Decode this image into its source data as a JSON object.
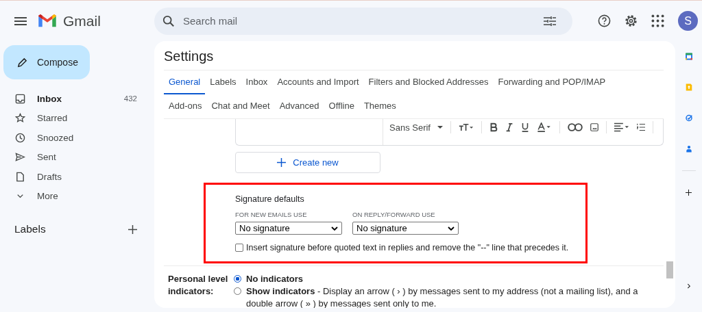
{
  "header": {
    "app_name": "Gmail",
    "search": {
      "placeholder": "Search mail"
    },
    "avatar_letter": "S"
  },
  "sidebar": {
    "compose": "Compose",
    "items": [
      {
        "label": "Inbox",
        "kind": "inbox",
        "count": "432",
        "unread": true
      },
      {
        "label": "Starred",
        "kind": "starred",
        "unread": false
      },
      {
        "label": "Snoozed",
        "kind": "snoozed",
        "unread": false
      },
      {
        "label": "Sent",
        "kind": "sent",
        "unread": false
      },
      {
        "label": "Drafts",
        "kind": "drafts",
        "unread": false
      },
      {
        "label": "More",
        "kind": "more",
        "unread": false
      }
    ],
    "labels_heading": "Labels"
  },
  "settings": {
    "title": "Settings",
    "tab_rows": [
      [
        {
          "label": "General",
          "selected": true
        },
        {
          "label": "Labels",
          "selected": false
        },
        {
          "label": "Inbox",
          "selected": false
        },
        {
          "label": "Accounts and Import",
          "selected": false
        },
        {
          "label": "Filters and Blocked Addresses",
          "selected": false
        },
        {
          "label": "Forwarding and POP/IMAP",
          "selected": false
        }
      ],
      [
        {
          "label": "Add-ons",
          "selected": false
        },
        {
          "label": "Chat and Meet",
          "selected": false
        },
        {
          "label": "Advanced",
          "selected": false
        },
        {
          "label": "Offline",
          "selected": false
        },
        {
          "label": "Themes",
          "selected": false
        }
      ]
    ],
    "editor_toolbar": {
      "font": "Sans Serif"
    },
    "create_button": "Create new",
    "signature_defaults": {
      "highlighted": true,
      "title": "Signature defaults",
      "selects": [
        {
          "label": "FOR NEW EMAILS USE",
          "value": "No signature"
        },
        {
          "label": "ON REPLY/FORWARD USE",
          "value": "No signature"
        }
      ],
      "insert_before_quoted": {
        "label": "Insert signature before quoted text in replies and remove the \"--\" line that precedes it.",
        "checked": false
      }
    },
    "personal_level_indicators": {
      "label": "Personal level indicators:",
      "options": [
        {
          "text": "No indicators",
          "selected": true
        },
        {
          "text": "**Show indicators** - Display an arrow ( › ) by messages sent to my address (not a mailing list), and a double arrow ( » ) by messages sent only to me.",
          "selected": false
        }
      ]
    }
  }
}
